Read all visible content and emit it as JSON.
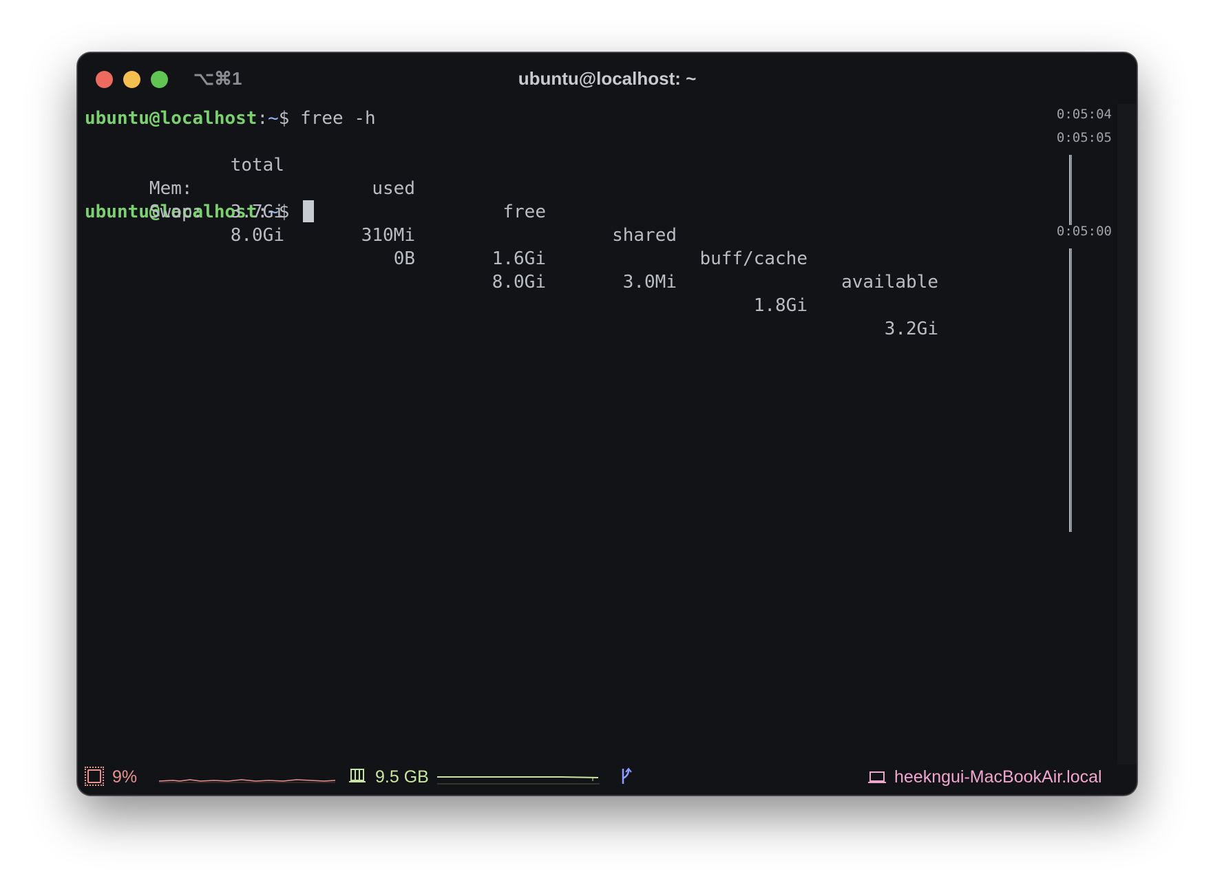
{
  "window": {
    "shortcut": "⌥⌘1",
    "title": "ubuntu@localhost: ~"
  },
  "terminal": {
    "prompt_user": "ubuntu@localhost",
    "prompt_path": "~",
    "prompt_sym": "$",
    "command": "free -h",
    "header": [
      "total",
      "used",
      "free",
      "shared",
      "buff/cache",
      "available"
    ],
    "rows": [
      {
        "label": "Mem:",
        "cells": [
          "3.7Gi",
          "310Mi",
          "1.6Gi",
          "3.0Mi",
          "1.8Gi",
          "3.2Gi"
        ]
      },
      {
        "label": "Swap:",
        "cells": [
          "8.0Gi",
          "0B",
          "8.0Gi",
          "",
          "",
          ""
        ]
      }
    ]
  },
  "timestamps": [
    "0:05:04",
    "0:05:05",
    "0:05:00"
  ],
  "status": {
    "cpu_icon": "cpu-icon",
    "cpu_value": "9%",
    "mem_icon": "memory-icon",
    "mem_value": "9.5 GB",
    "branch_icon": "git-branch-icon",
    "host_icon": "laptop-icon",
    "hostname": "heekngui-MacBookAir.local"
  },
  "colors": {
    "prompt": "#7bd06f",
    "path": "#8fb6ff",
    "cpu": "#e8928f",
    "mem": "#c9e6a0",
    "host": "#f0a5d0"
  }
}
